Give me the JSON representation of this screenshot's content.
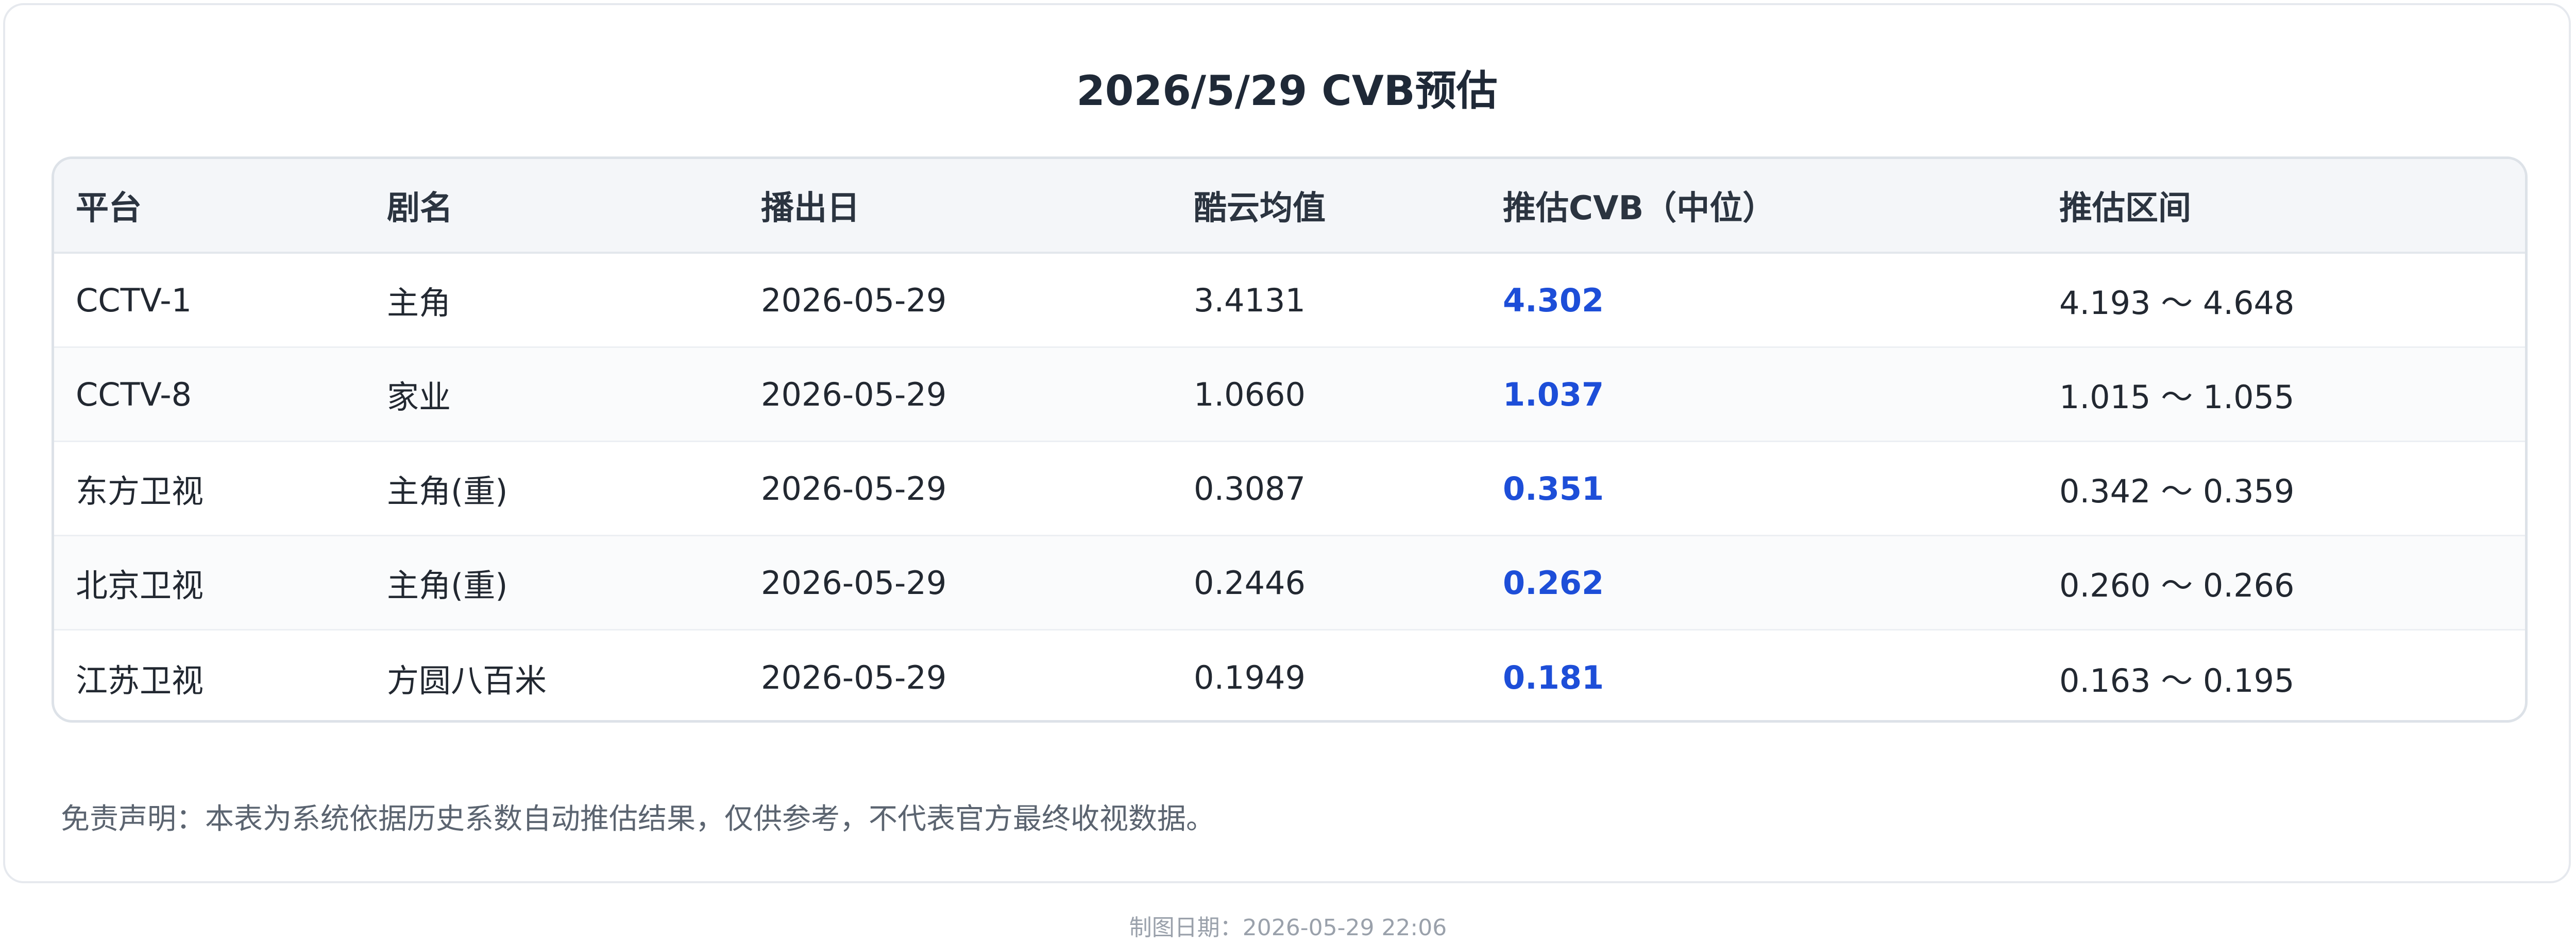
{
  "title": "2026/5/29 CVB预估",
  "table": {
    "headers": [
      "平台",
      "剧名",
      "播出日",
      "酷云均值",
      "推估CVB（中位）",
      "推估区间"
    ],
    "rows": [
      {
        "platform": "CCTV-1",
        "drama": "主角",
        "air_date": "2026-05-29",
        "kuyun_avg": "3.4131",
        "cvb": "4.302",
        "range": "4.193 ～ 4.648"
      },
      {
        "platform": "CCTV-8",
        "drama": "家业",
        "air_date": "2026-05-29",
        "kuyun_avg": "1.0660",
        "cvb": "1.037",
        "range": "1.015 ～ 1.055"
      },
      {
        "platform": "东方卫视",
        "drama": "主角(重)",
        "air_date": "2026-05-29",
        "kuyun_avg": "0.3087",
        "cvb": "0.351",
        "range": "0.342 ～ 0.359"
      },
      {
        "platform": "北京卫视",
        "drama": "主角(重)",
        "air_date": "2026-05-29",
        "kuyun_avg": "0.2446",
        "cvb": "0.262",
        "range": "0.260 ～ 0.266"
      },
      {
        "platform": "江苏卫视",
        "drama": "方圆八百米",
        "air_date": "2026-05-29",
        "kuyun_avg": "0.1949",
        "cvb": "0.181",
        "range": "0.163 ～ 0.195"
      }
    ]
  },
  "disclaimer": "免责声明：本表为系统依据历史系数自动推估结果，仅供参考，不代表官方最终收视数据。",
  "footer": "制图日期：2026-05-29 22:06",
  "colors": {
    "accent": "#1d4ed8",
    "header_bg": "#f4f6f9",
    "border": "#dde2e8"
  }
}
